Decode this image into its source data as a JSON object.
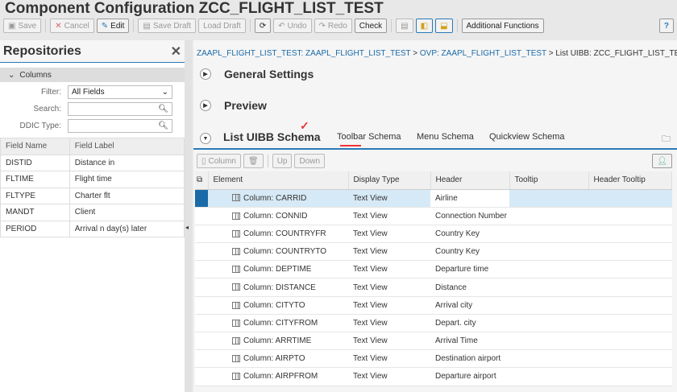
{
  "title": "Component Configuration ZCC_FLIGHT_LIST_TEST",
  "toolbar": {
    "save": "Save",
    "cancel": "Cancel",
    "edit": "Edit",
    "save_draft": "Save Draft",
    "load_draft": "Load Draft",
    "undo": "Undo",
    "redo": "Redo",
    "check": "Check",
    "additional": "Additional Functions"
  },
  "repo": {
    "title": "Repositories",
    "section": "Columns",
    "filter_label": "Filter:",
    "filter_value": "All Fields",
    "search_label": "Search:",
    "ddic_label": "DDIC Type:",
    "headers": [
      "Field Name",
      "Field Label"
    ],
    "rows": [
      [
        "DISTID",
        "Distance in"
      ],
      [
        "FLTIME",
        "Flight time"
      ],
      [
        "FLTYPE",
        "Charter flt"
      ],
      [
        "MANDT",
        "Client"
      ],
      [
        "PERIOD",
        "Arrival n day(s) later"
      ]
    ]
  },
  "breadcrumb": {
    "a": "ZAAPL_FLIGHT_LIST_TEST: ZAAPL_FLIGHT_LIST_TEST",
    "sep": ">",
    "b": "OVP: ZAAPL_FLIGHT_LIST_TEST",
    "c": "List UIBB: ZCC_FLIGHT_LIST_TEST"
  },
  "sections": {
    "general": "General Settings",
    "preview": "Preview"
  },
  "tabs": [
    "List UIBB Schema",
    "Toolbar Schema",
    "Menu Schema",
    "Quickview Schema"
  ],
  "subtoolbar": {
    "column": "Column",
    "up": "Up",
    "down": "Down"
  },
  "grid": {
    "headers": [
      "Element",
      "Display Type",
      "Header",
      "Tooltip",
      "Header Tooltip"
    ],
    "rows": [
      [
        "Column: CARRID",
        "Text View",
        "Airline"
      ],
      [
        "Column: CONNID",
        "Text View",
        "Connection Number"
      ],
      [
        "Column: COUNTRYFR",
        "Text View",
        "Country Key"
      ],
      [
        "Column: COUNTRYTO",
        "Text View",
        "Country Key"
      ],
      [
        "Column: DEPTIME",
        "Text View",
        "Departure time"
      ],
      [
        "Column: DISTANCE",
        "Text View",
        "Distance"
      ],
      [
        "Column: CITYTO",
        "Text View",
        "Arrival city"
      ],
      [
        "Column: CITYFROM",
        "Text View",
        "Depart. city"
      ],
      [
        "Column: ARRTIME",
        "Text View",
        "Arrival Time"
      ],
      [
        "Column: AIRPTO",
        "Text View",
        "Destination airport"
      ],
      [
        "Column: AIRPFROM",
        "Text View",
        "Departure airport"
      ]
    ]
  }
}
